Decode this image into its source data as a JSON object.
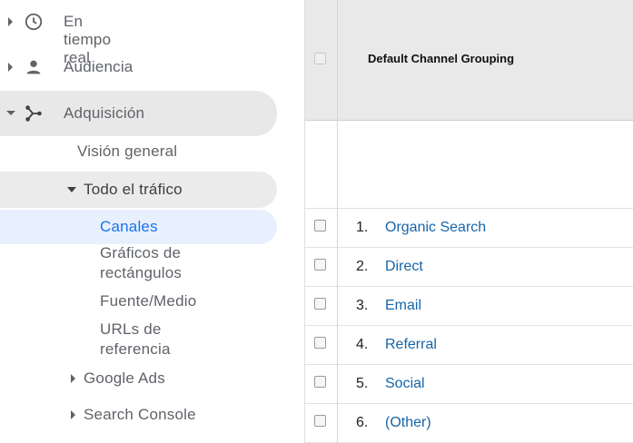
{
  "nav": {
    "items": [
      {
        "label": "En tiempo real",
        "icon": "clock-icon",
        "expanded": false
      },
      {
        "label": "Audiencia",
        "icon": "person-icon",
        "expanded": false
      },
      {
        "label": "Adquisición",
        "icon": "acquisition-icon",
        "expanded": true
      }
    ],
    "acquisition_sub": {
      "overview": "Visión general",
      "all_traffic": "Todo el tráfico",
      "channels": "Canales",
      "treemaps_line1": "Gráficos de",
      "treemaps_line2": "rectángulos",
      "source_medium": "Fuente/Medio",
      "referrals_line1": "URLs de",
      "referrals_line2": "referencia",
      "google_ads": "Google Ads",
      "search_console": "Search Console"
    }
  },
  "table": {
    "header_title": "Default Channel Grouping",
    "rows": [
      {
        "num": "1.",
        "label": "Organic Search"
      },
      {
        "num": "2.",
        "label": "Direct"
      },
      {
        "num": "3.",
        "label": "Email"
      },
      {
        "num": "4.",
        "label": "Referral"
      },
      {
        "num": "5.",
        "label": "Social"
      },
      {
        "num": "6.",
        "label": "(Other)"
      }
    ]
  },
  "colors": {
    "selected_text": "#1a73e8",
    "selected_bg": "#e8f0fe",
    "active_bg": "#e8e8e8",
    "link": "#1565a8"
  }
}
